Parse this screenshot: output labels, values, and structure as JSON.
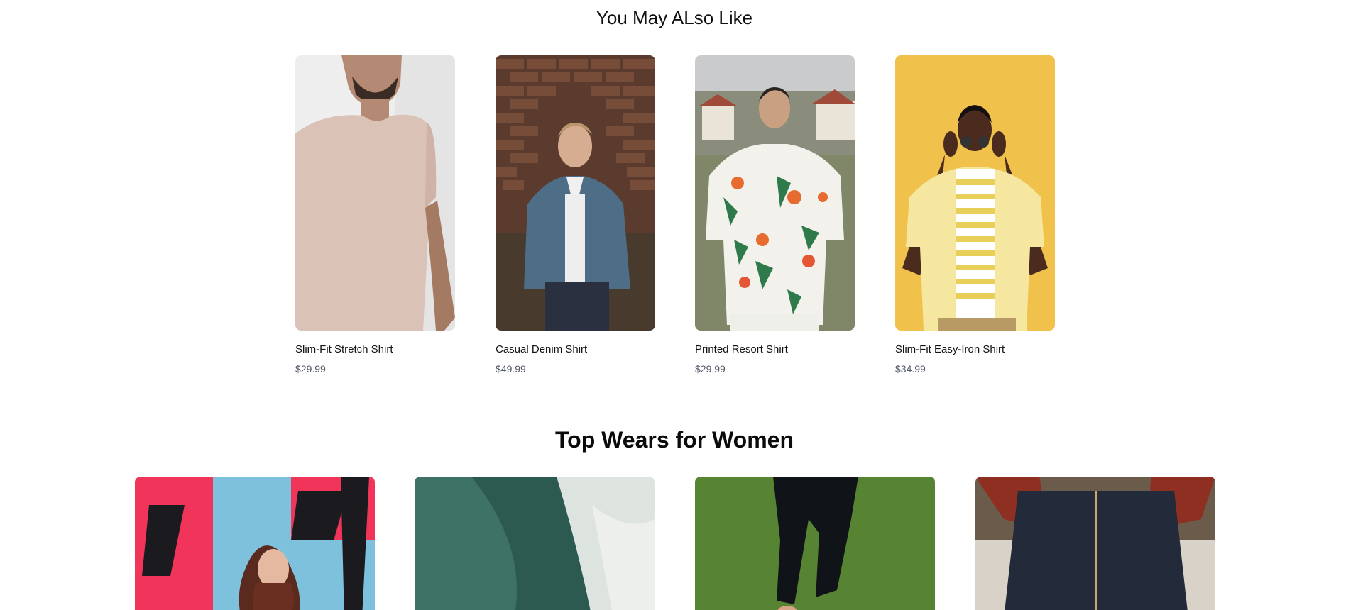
{
  "recommendations": {
    "title": "You May ALso Like",
    "products": [
      {
        "name": "Slim-Fit Stretch Shirt",
        "price": "$29.99"
      },
      {
        "name": "Casual Denim Shirt",
        "price": "$49.99"
      },
      {
        "name": "Printed Resort Shirt",
        "price": "$29.99"
      },
      {
        "name": "Slim-Fit Easy-Iron Shirt",
        "price": "$34.99"
      }
    ]
  },
  "women_section": {
    "title": "Top Wears for Women"
  },
  "scrollbar": {
    "up_icon": "triangle-up-icon",
    "down_icon": "triangle-down-icon"
  }
}
